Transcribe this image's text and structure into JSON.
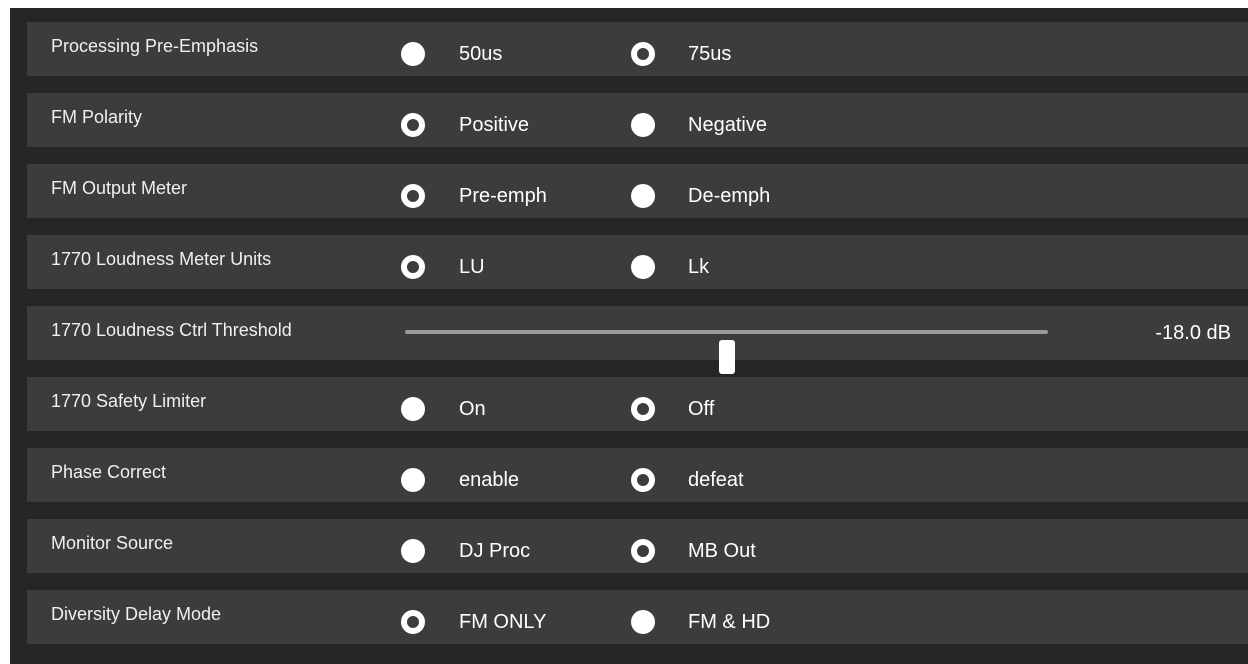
{
  "colors": {
    "panel_bg": "#262626",
    "row_bg": "#3c3c3c",
    "text": "#ffffff",
    "slider_track": "#9a9a9a"
  },
  "rows": [
    {
      "label": "Processing Pre-Emphasis",
      "options": [
        {
          "label": "50us",
          "selected": false
        },
        {
          "label": "75us",
          "selected": true
        }
      ]
    },
    {
      "label": "FM Polarity",
      "options": [
        {
          "label": "Positive",
          "selected": true
        },
        {
          "label": "Negative",
          "selected": false
        }
      ]
    },
    {
      "label": "FM Output Meter",
      "options": [
        {
          "label": "Pre-emph",
          "selected": true
        },
        {
          "label": "De-emph",
          "selected": false
        }
      ]
    },
    {
      "label": "1770 Loudness Meter Units",
      "options": [
        {
          "label": "LU",
          "selected": true
        },
        {
          "label": "Lk",
          "selected": false
        }
      ]
    },
    {
      "label": "1770 Loudness Ctrl Threshold",
      "slider": {
        "value_text": "-18.0 dB",
        "fraction": 0.5
      }
    },
    {
      "label": "1770 Safety Limiter",
      "options": [
        {
          "label": "On",
          "selected": false
        },
        {
          "label": "Off",
          "selected": true
        }
      ]
    },
    {
      "label": "Phase Correct",
      "options": [
        {
          "label": "enable",
          "selected": false
        },
        {
          "label": "defeat",
          "selected": true
        }
      ]
    },
    {
      "label": "Monitor Source",
      "options": [
        {
          "label": "DJ Proc",
          "selected": false
        },
        {
          "label": "MB Out",
          "selected": true
        }
      ]
    },
    {
      "label": "Diversity Delay Mode",
      "options": [
        {
          "label": "FM ONLY",
          "selected": true
        },
        {
          "label": "FM & HD",
          "selected": false
        }
      ]
    }
  ]
}
